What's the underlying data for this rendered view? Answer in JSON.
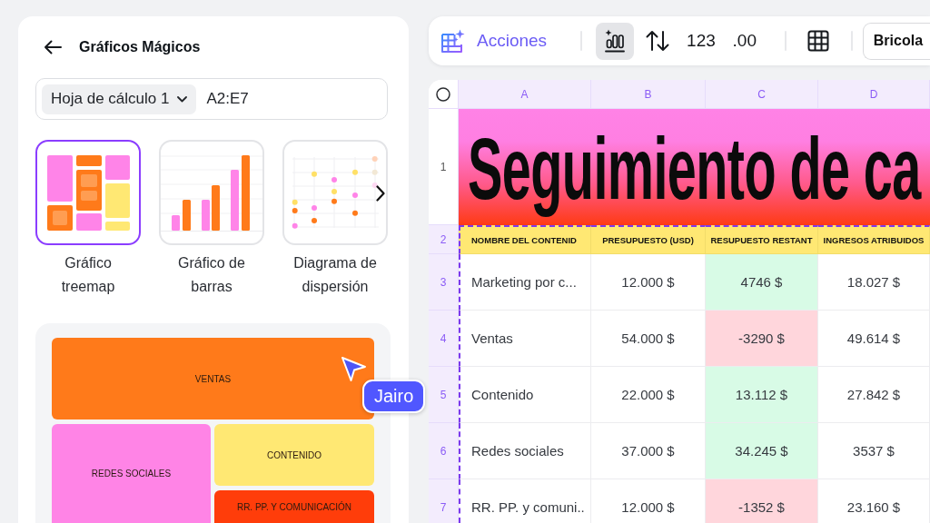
{
  "panel": {
    "title": "Gráficos Mágicos",
    "sheet_select": {
      "value": "Hoja de cálculo 1"
    },
    "range": {
      "value": "A2:E7"
    },
    "chart_types": [
      {
        "kind": "treemap",
        "label": "Gráfico treemap",
        "selected": true
      },
      {
        "kind": "bar",
        "label": "Gráfico de barras",
        "selected": false
      },
      {
        "kind": "scatter",
        "label": "Diagrama de dispersión",
        "selected": false
      }
    ],
    "preview": {
      "tiles": [
        {
          "label": "VENTAS",
          "color": "#ff7a1a"
        },
        {
          "label": "REDES SOCIALES",
          "color": "#ff84e6"
        },
        {
          "label": "CONTENIDO",
          "color": "#ffe873"
        },
        {
          "label": "RR. PP. Y COMUNICACIÓN",
          "color": "#ff3d0a"
        }
      ]
    }
  },
  "collaborator": {
    "name": "Jairo"
  },
  "toolbar": {
    "actions": {
      "label": "Acciones"
    },
    "tool_groups": [
      {
        "tools": [
          {
            "kind": "chart",
            "selected": true
          },
          {
            "kind": "sort",
            "selected": false
          },
          {
            "kind": "text",
            "label": "123",
            "selected": false
          },
          {
            "kind": "text",
            "label": ".00",
            "selected": false
          }
        ]
      },
      {
        "tools": [
          {
            "kind": "grid",
            "selected": false
          }
        ]
      }
    ],
    "font_select": {
      "value": "Bricola"
    }
  },
  "sheet": {
    "columns": [
      {
        "label": "A",
        "selected": true
      },
      {
        "label": "B",
        "selected": true
      },
      {
        "label": "C",
        "selected": true
      },
      {
        "label": "D",
        "selected": true
      }
    ],
    "rows": [
      {
        "kind": "title",
        "number": "1",
        "selected": false,
        "text": "Seguimiento de ca"
      },
      {
        "kind": "header",
        "number": "2",
        "selected": true,
        "cells": [
          {
            "text": "NOMBRE DEL CONTENID"
          },
          {
            "text": "PRESUPUESTO (USD)"
          },
          {
            "text": "RESUPUESTO RESTANT"
          },
          {
            "text": "INGRESOS ATRIBUIDOS"
          }
        ]
      },
      {
        "kind": "data",
        "number": "3",
        "selected": true,
        "cells": [
          {
            "text": "Marketing por c..."
          },
          {
            "text": "12.000 $"
          },
          {
            "text": "4746 $",
            "color": "#d8fbe6"
          },
          {
            "text": "18.027 $"
          }
        ]
      },
      {
        "kind": "data",
        "number": "4",
        "selected": true,
        "cells": [
          {
            "text": "Ventas"
          },
          {
            "text": "54.000 $"
          },
          {
            "text": "-3290 $",
            "color": "#ffd6dc"
          },
          {
            "text": "49.614 $"
          }
        ]
      },
      {
        "kind": "data",
        "number": "5",
        "selected": true,
        "cells": [
          {
            "text": "Contenido"
          },
          {
            "text": "22.000 $"
          },
          {
            "text": "13.112 $",
            "color": "#d8fbe6"
          },
          {
            "text": "27.842 $"
          }
        ]
      },
      {
        "kind": "data",
        "number": "6",
        "selected": true,
        "cells": [
          {
            "text": "Redes sociales"
          },
          {
            "text": "37.000 $"
          },
          {
            "text": "34.245 $",
            "color": "#d8fbe6"
          },
          {
            "text": "3537 $"
          }
        ]
      },
      {
        "kind": "data",
        "number": "7",
        "selected": true,
        "cells": [
          {
            "text": "RR. PP. y comuni.."
          },
          {
            "text": "12.000 $"
          },
          {
            "text": "-1352 $",
            "color": "#ffd6dc"
          },
          {
            "text": "23.160 $"
          }
        ]
      }
    ]
  }
}
